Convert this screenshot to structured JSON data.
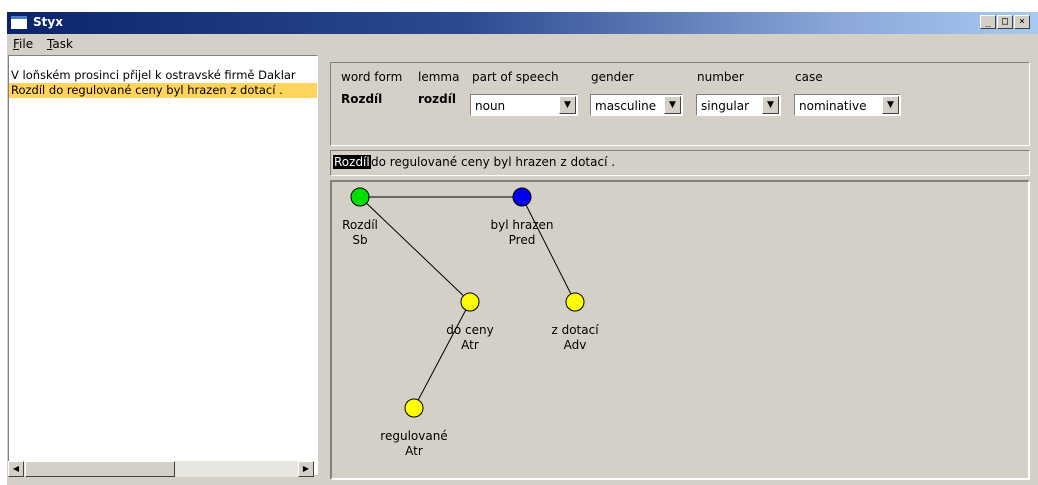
{
  "window": {
    "title": "Styx",
    "controls": [
      "_",
      "□",
      "×"
    ]
  },
  "menu": [
    {
      "underline": "F",
      "rest": "ile"
    },
    {
      "underline": "T",
      "rest": "ask"
    }
  ],
  "sentences": [
    {
      "text": "V loňském prosinci přijel k ostravské firmě Daklar",
      "selected": false
    },
    {
      "text": "Rozdíl do regulované ceny byl hrazen z dotací .",
      "selected": true
    }
  ],
  "attributes": {
    "word_form": {
      "label": "word form",
      "value": "Rozdíl"
    },
    "lemma": {
      "label": "lemma",
      "value": "rozdíl"
    },
    "part_of_speech": {
      "label": "part of speech",
      "value": "noun"
    },
    "gender": {
      "label": "gender",
      "value": "masculine"
    },
    "number": {
      "label": "number",
      "value": "singular"
    },
    "case": {
      "label": "case",
      "value": "nominative"
    }
  },
  "current_sentence": {
    "highlighted": "Rozdíl",
    "rest": "do regulované ceny byl hrazen z dotací ."
  },
  "tree": {
    "nodes": [
      {
        "id": "rozdil",
        "word": "Rozdíl",
        "func": "Sb",
        "color": "#00e000"
      },
      {
        "id": "byl-hrazen",
        "word": "byl hrazen",
        "func": "Pred",
        "color": "#0000ee"
      },
      {
        "id": "do-ceny",
        "word": "do ceny",
        "func": "Atr",
        "color": "#ffff00"
      },
      {
        "id": "z-dotaci",
        "word": "z dotací",
        "func": "Adv",
        "color": "#ffff00"
      },
      {
        "id": "regulovane",
        "word": "regulované",
        "func": "Atr",
        "color": "#ffff00"
      }
    ],
    "edges": [
      [
        "rozdil",
        "byl-hrazen"
      ],
      [
        "rozdil",
        "do-ceny"
      ],
      [
        "byl-hrazen",
        "z-dotaci"
      ],
      [
        "do-ceny",
        "regulovane"
      ]
    ]
  },
  "scrollbar": {
    "left_arrow": "◀",
    "right_arrow": "▶"
  },
  "combo_arrow": "▼"
}
